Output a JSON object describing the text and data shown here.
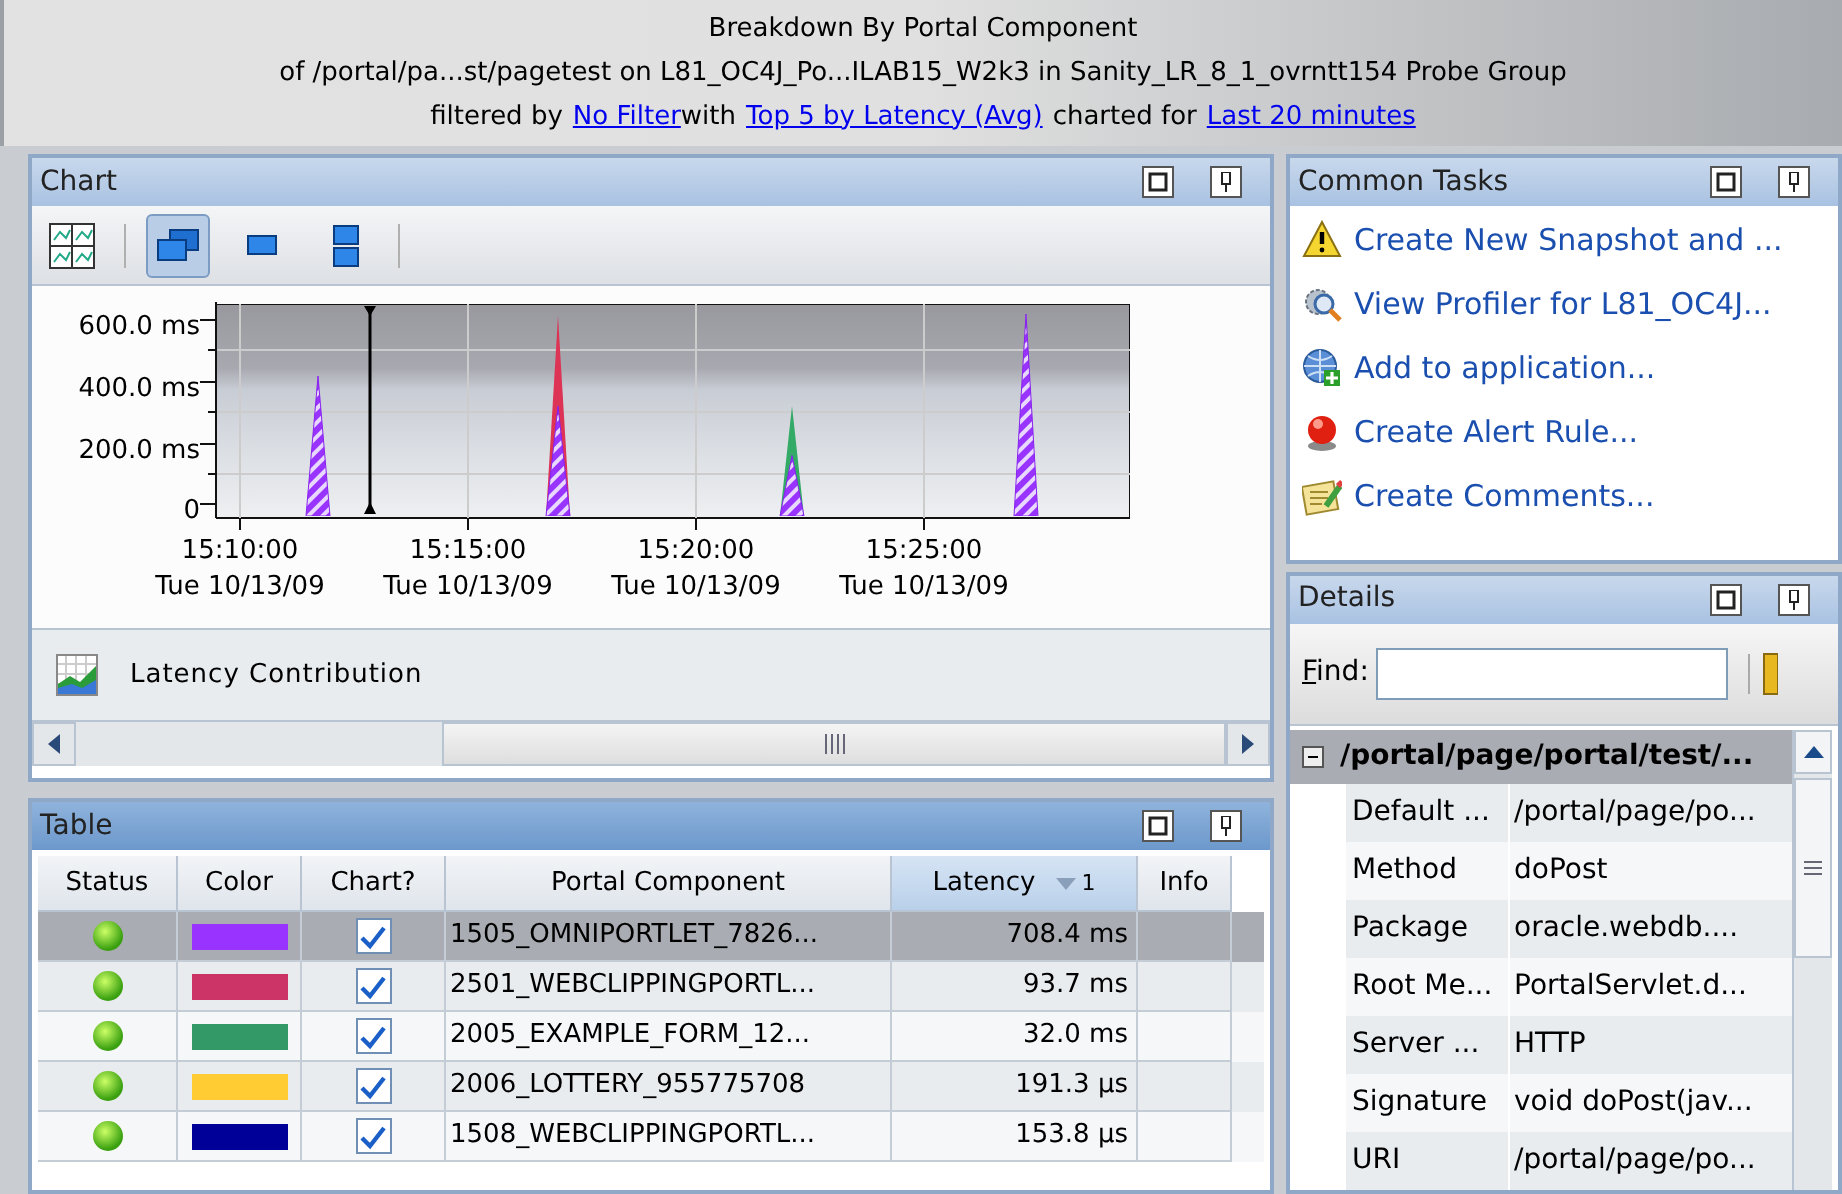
{
  "header": {
    "title": "Breakdown By Portal Component",
    "subtitle": "of /portal/pa...st/pagetest on L81_OC4J_Po...ILAB15_W2k3 in Sanity_LR_8_1_ovrntt154 Probe Group",
    "filter_parts": [
      {
        "kind": "text",
        "text": "filtered by"
      },
      {
        "kind": "link",
        "text": "No Filter"
      },
      {
        "kind": "text",
        "text": "with"
      },
      {
        "kind": "link",
        "text": "Top 5 by Latency (Avg)"
      },
      {
        "kind": "text",
        "text": "charted for"
      },
      {
        "kind": "link",
        "text": "Last 20 minutes"
      }
    ]
  },
  "chart_panel": {
    "title": "Chart",
    "toolbar": [
      {
        "kind": "grid",
        "selected": false
      },
      {
        "kind": "overlap",
        "selected": true
      },
      {
        "kind": "single",
        "selected": false
      },
      {
        "kind": "stacked",
        "selected": false
      }
    ],
    "y_tick_labels": [
      "600.0 ms",
      "400.0 ms",
      "200.0 ms",
      "0"
    ],
    "x_tick_labels": [
      {
        "time": "15:10:00",
        "date": "Tue 10/13/09"
      },
      {
        "time": "15:15:00",
        "date": "Tue 10/13/09"
      },
      {
        "time": "15:20:00",
        "date": "Tue 10/13/09"
      },
      {
        "time": "15:25:00",
        "date": "Tue 10/13/09"
      }
    ],
    "legend": "Latency Contribution"
  },
  "table_panel": {
    "title": "Table",
    "columns": [
      "Status",
      "Color",
      "Chart?",
      "Portal Component",
      "Latency",
      "Info"
    ],
    "sort_index": "1",
    "rows": [
      {
        "selected": true,
        "color": "#9933ff",
        "charted": true,
        "component": "1505_OMNIPORTLET_7826...",
        "latency": "708.4 ms"
      },
      {
        "selected": false,
        "color": "#cc3366",
        "charted": true,
        "component": "2501_WEBCLIPPINGPORTL...",
        "latency": "93.7 ms"
      },
      {
        "selected": false,
        "color": "#339966",
        "charted": true,
        "component": "2005_EXAMPLE_FORM_12...",
        "latency": "32.0 ms"
      },
      {
        "selected": false,
        "color": "#ffcc33",
        "charted": true,
        "component": "2006_LOTTERY_955775708",
        "latency": "191.3 µs"
      },
      {
        "selected": false,
        "color": "#000099",
        "charted": true,
        "component": "1508_WEBCLIPPINGPORTL...",
        "latency": "153.8 µs"
      }
    ]
  },
  "tasks_panel": {
    "title": "Common Tasks",
    "items": [
      {
        "kind": "warning",
        "label": "Create New Snapshot and ..."
      },
      {
        "kind": "profiler",
        "label": "View Profiler for L81_OC4J..."
      },
      {
        "kind": "add",
        "label": "Add to application..."
      },
      {
        "kind": "alert",
        "label": "Create Alert Rule..."
      },
      {
        "kind": "comment",
        "label": "Create Comments..."
      }
    ]
  },
  "details_panel": {
    "title": "Details",
    "find_label": "Find:",
    "group": {
      "label": "/portal/page/portal/test/...",
      "expanded": true,
      "children": [
        {
          "name": "Default ...",
          "value": "/portal/page/po..."
        },
        {
          "name": "Method",
          "value": "doPost"
        },
        {
          "name": "Package",
          "value": "oracle.webdb...."
        },
        {
          "name": "Root Me...",
          "value": "PortalServlet.d..."
        },
        {
          "name": "Server ...",
          "value": "HTTP"
        },
        {
          "name": "Signature",
          "value": "void doPost(jav..."
        },
        {
          "name": "URI",
          "value": "/portal/page/po..."
        }
      ]
    }
  }
}
